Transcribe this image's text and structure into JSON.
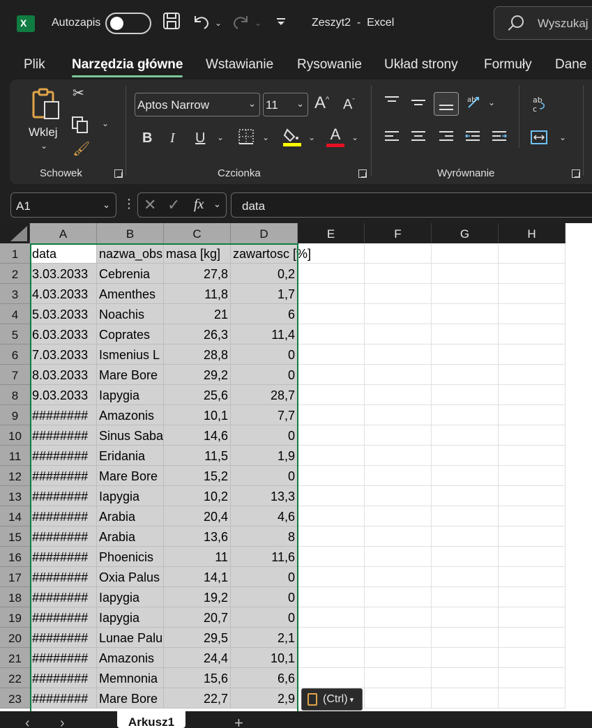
{
  "titlebar": {
    "app_icon_letter": "X",
    "autosave_label": "Autozapis",
    "autosave_on": false,
    "doc_title": "Zeszyt2  -  Excel",
    "search_placeholder": "Wyszukaj"
  },
  "tabs": [
    {
      "label": "Plik",
      "active": false
    },
    {
      "label": "Narzędzia główne",
      "active": true
    },
    {
      "label": "Wstawianie",
      "active": false
    },
    {
      "label": "Rysowanie",
      "active": false
    },
    {
      "label": "Układ strony",
      "active": false
    },
    {
      "label": "Formuły",
      "active": false
    },
    {
      "label": "Dane",
      "active": false
    }
  ],
  "ribbon": {
    "clipboard": {
      "label": "Schowek",
      "paste_label": "Wklej"
    },
    "font": {
      "label": "Czcionka",
      "font_name": "Aptos Narrow",
      "font_size": "11",
      "bold": "B",
      "italic": "I",
      "underline": "U",
      "font_color_glyph": "A",
      "grow_glyph": "A",
      "shrink_glyph": "A"
    },
    "alignment": {
      "label": "Wyrównanie"
    }
  },
  "formula_bar": {
    "name_box": "A1",
    "fx": "fx",
    "formula": "data"
  },
  "columns": [
    "A",
    "B",
    "C",
    "D",
    "E",
    "F",
    "G",
    "H"
  ],
  "selected_columns": [
    "A",
    "B",
    "C",
    "D"
  ],
  "rows": [
    {
      "n": "1",
      "a": "data",
      "b": "nazwa_obs",
      "c": "masa [kg]",
      "d": "zawartosc [%]"
    },
    {
      "n": "2",
      "a": "3.03.2033",
      "b": "Cebrenia",
      "c": "27,8",
      "d": "0,2"
    },
    {
      "n": "3",
      "a": "4.03.2033",
      "b": "Amenthes",
      "c": "11,8",
      "d": "1,7"
    },
    {
      "n": "4",
      "a": "5.03.2033",
      "b": "Noachis",
      "c": "21",
      "d": "6"
    },
    {
      "n": "5",
      "a": "6.03.2033",
      "b": "Coprates",
      "c": "26,3",
      "d": "11,4"
    },
    {
      "n": "6",
      "a": "7.03.2033",
      "b": "Ismenius L",
      "c": "28,8",
      "d": "0"
    },
    {
      "n": "7",
      "a": "8.03.2033",
      "b": "Mare Bore",
      "c": "29,2",
      "d": "0"
    },
    {
      "n": "8",
      "a": "9.03.2033",
      "b": "Iapygia",
      "c": "25,6",
      "d": "28,7"
    },
    {
      "n": "9",
      "a": "########",
      "b": "Amazonis",
      "c": "10,1",
      "d": "7,7"
    },
    {
      "n": "10",
      "a": "########",
      "b": "Sinus Saba",
      "c": "14,6",
      "d": "0"
    },
    {
      "n": "11",
      "a": "########",
      "b": "Eridania",
      "c": "11,5",
      "d": "1,9"
    },
    {
      "n": "12",
      "a": "########",
      "b": "Mare Bore",
      "c": "15,2",
      "d": "0"
    },
    {
      "n": "13",
      "a": "########",
      "b": "Iapygia",
      "c": "10,2",
      "d": "13,3"
    },
    {
      "n": "14",
      "a": "########",
      "b": "Arabia",
      "c": "20,4",
      "d": "4,6"
    },
    {
      "n": "15",
      "a": "########",
      "b": "Arabia",
      "c": "13,6",
      "d": "8"
    },
    {
      "n": "16",
      "a": "########",
      "b": "Phoenicis",
      "c": "11",
      "d": "11,6"
    },
    {
      "n": "17",
      "a": "########",
      "b": "Oxia Palus",
      "c": "14,1",
      "d": "0"
    },
    {
      "n": "18",
      "a": "########",
      "b": "Iapygia",
      "c": "19,2",
      "d": "0"
    },
    {
      "n": "19",
      "a": "########",
      "b": "Iapygia",
      "c": "20,7",
      "d": "0"
    },
    {
      "n": "20",
      "a": "########",
      "b": "Lunae Palu",
      "c": "29,5",
      "d": "2,1"
    },
    {
      "n": "21",
      "a": "########",
      "b": "Amazonis",
      "c": "24,4",
      "d": "10,1"
    },
    {
      "n": "22",
      "a": "########",
      "b": "Memnonia",
      "c": "15,6",
      "d": "6,6"
    },
    {
      "n": "23",
      "a": "########",
      "b": "Mare Bore",
      "c": "22,7",
      "d": "2,9"
    }
  ],
  "paste_options": "(Ctrl)",
  "sheet_tab": "Arkusz1",
  "colors": {
    "accent": "#107c41",
    "selection": "#d2d2d2",
    "tab_underline": "#7cc79a"
  }
}
